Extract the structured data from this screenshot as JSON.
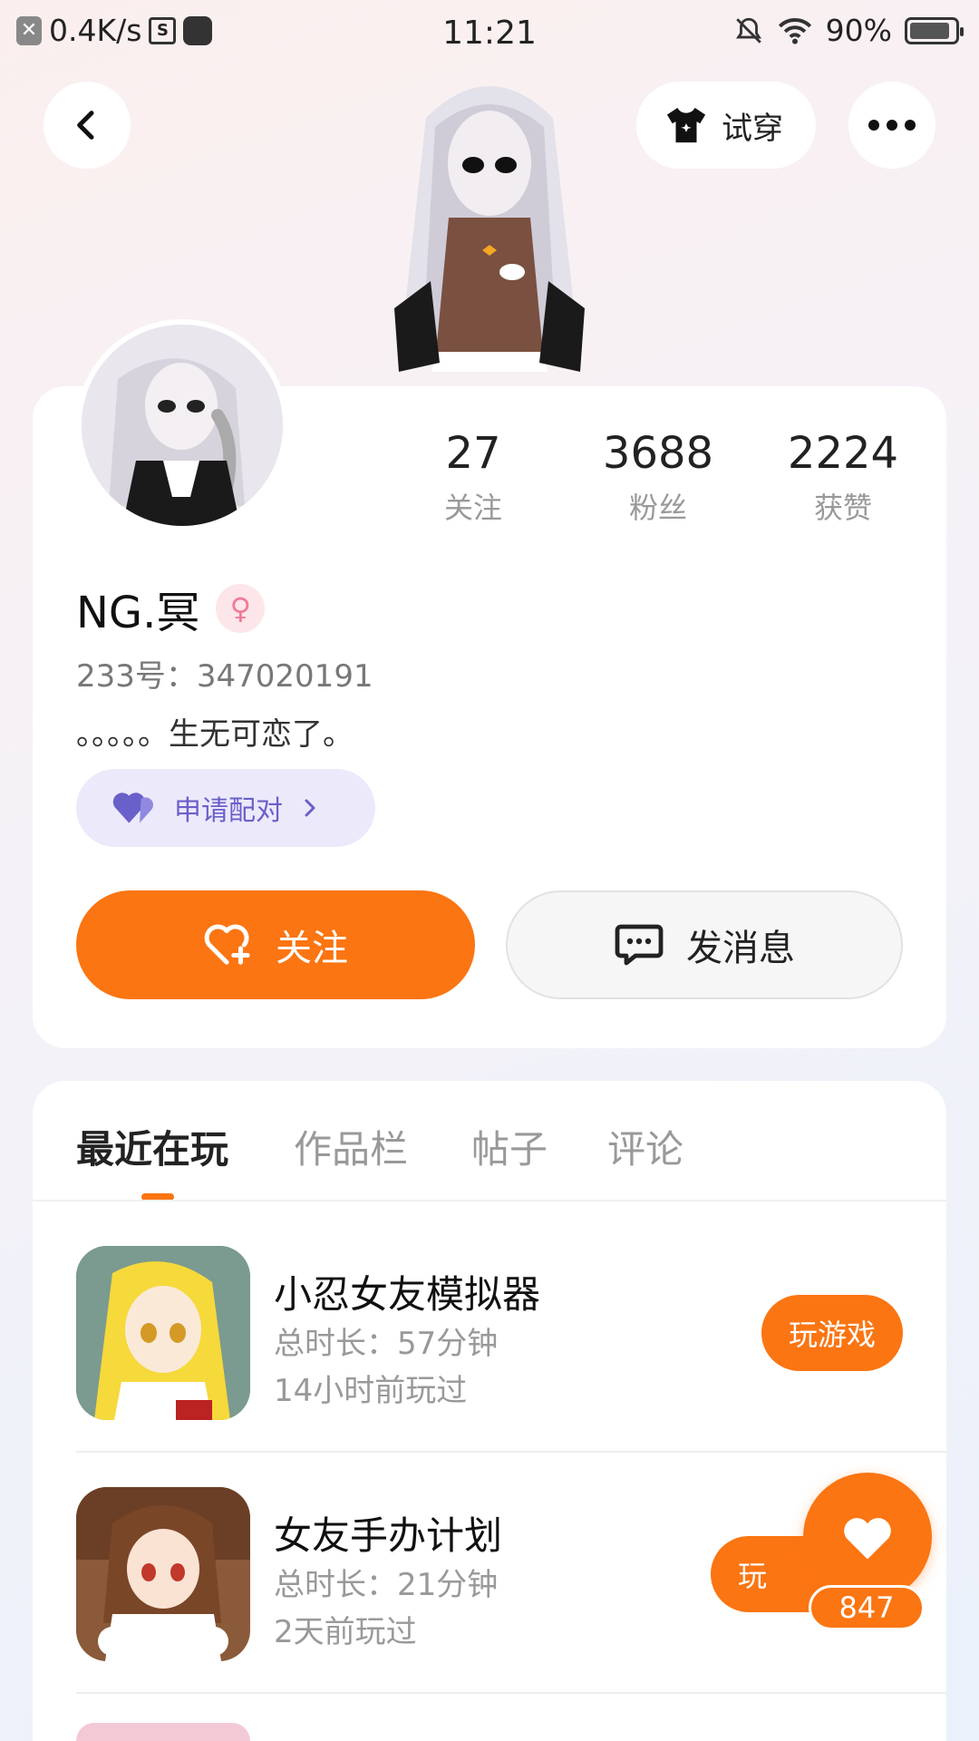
{
  "status_bar": {
    "net_speed": "0.4K/s",
    "time": "11:21",
    "battery": "90%",
    "battery_level": 0.9
  },
  "header": {
    "try_on_label": "试穿"
  },
  "profile": {
    "stats": [
      {
        "value": "27",
        "label": "关注"
      },
      {
        "value": "3688",
        "label": "粉丝"
      },
      {
        "value": "2224",
        "label": "获赞"
      }
    ],
    "nickname": "NG.冥",
    "gender_symbol": "♀",
    "uid": "233号：347020191",
    "bio": "。。。。。生无可恋了。",
    "pair_label": "申请配对",
    "follow_label": "关注",
    "message_label": "发消息"
  },
  "tabs": [
    {
      "label": "最近在玩",
      "active": true
    },
    {
      "label": "作品栏",
      "active": false
    },
    {
      "label": "帖子",
      "active": false
    },
    {
      "label": "评论",
      "active": false
    }
  ],
  "games": [
    {
      "title": "小忍女友模拟器",
      "duration": "总时长：57分钟",
      "last_played": "14小时前玩过",
      "button": "玩游戏"
    },
    {
      "title": "女友手办计划",
      "duration": "总时长：21分钟",
      "last_played": "2天前玩过",
      "button": "玩"
    }
  ],
  "like": {
    "count": "847"
  },
  "colors": {
    "accent": "#fb7512",
    "pair_bg": "#ece9fb",
    "pair_text": "#6a60c9",
    "gender_bg": "#fde6ea"
  }
}
